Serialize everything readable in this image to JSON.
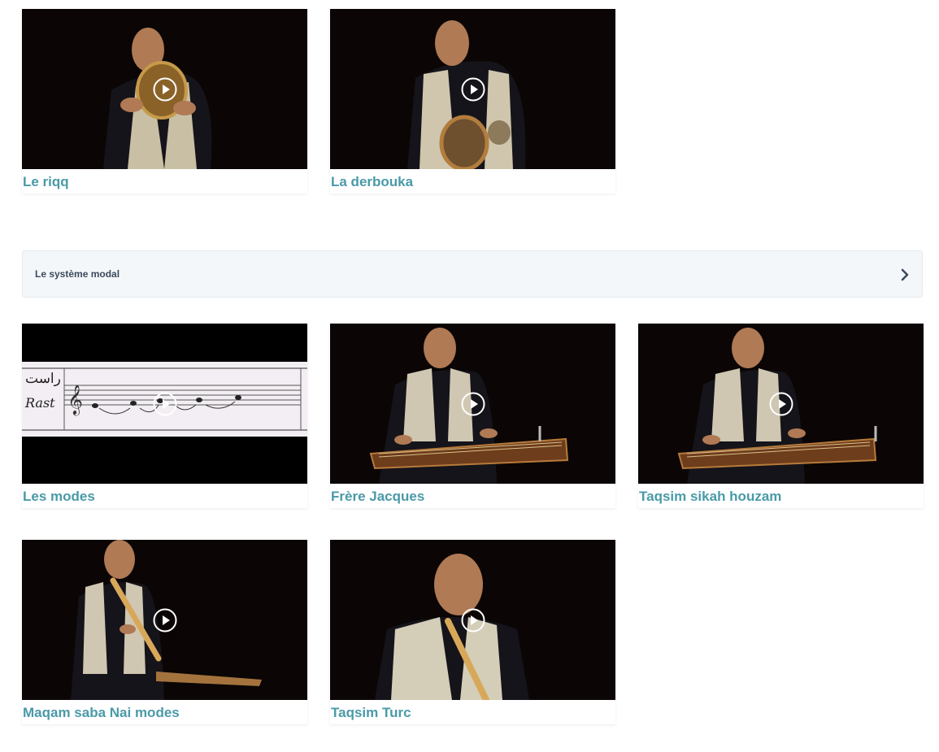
{
  "row1": [
    {
      "title": "Le riqq"
    },
    {
      "title": "La derbouka"
    }
  ],
  "section": {
    "title": "Le système modal"
  },
  "row2": [
    {
      "title": "Les modes"
    },
    {
      "title": "Frère Jacques"
    },
    {
      "title": "Taqsim sikah houzam"
    }
  ],
  "row3": [
    {
      "title": "Maqam saba Nai modes"
    },
    {
      "title": "Taqsim Turc"
    }
  ],
  "score": {
    "label_arabic": "راست",
    "label_latin": "Rast"
  },
  "colors": {
    "title": "#4a9aa8",
    "section_bg": "#f4f7f9",
    "section_text": "#3a4a5c"
  }
}
